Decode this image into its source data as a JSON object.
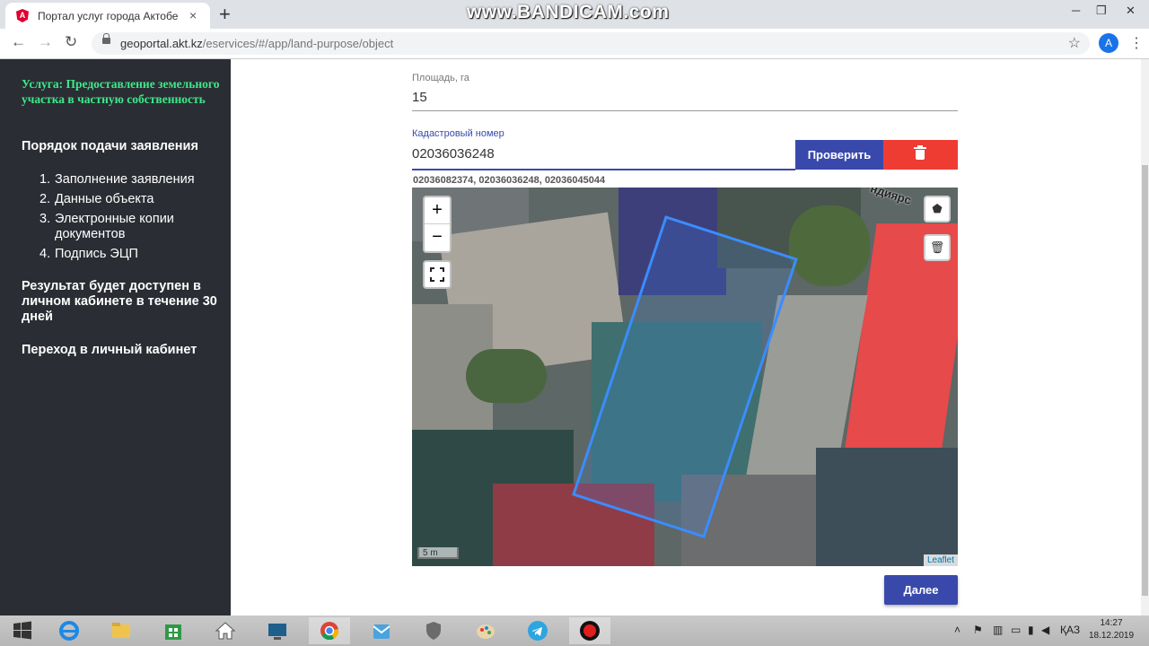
{
  "browser": {
    "tab_title": "Портал услуг города Актобе",
    "tab_close": "×",
    "new_tab": "+",
    "url_host": "geoportal.akt.kz",
    "url_path": "/eservices/#/app/land-purpose/object",
    "avatar_letter": "A",
    "watermark": "www.BANDICAM.com",
    "minimize": "─",
    "restore": "❐",
    "close": "✕"
  },
  "sidebar": {
    "service_title": "Услуга: Предоставление земельного участка в частную собственность",
    "procedure_heading": "Порядок подачи заявления",
    "steps": [
      {
        "num": "1.",
        "label": "Заполнение заявления"
      },
      {
        "num": "2.",
        "label": "Данные объекта"
      },
      {
        "num": "3.",
        "label": "Электронные копии документов"
      },
      {
        "num": "4.",
        "label": "Подпись ЭЦП"
      }
    ],
    "result_note": "Результат будет доступен в личном кабинете в течение 30 дней",
    "cabinet_link": "Переход в личный кабинет"
  },
  "form": {
    "area_label": "Площадь, га",
    "area_value": "15",
    "cadastral_label": "Кадастровый номер",
    "cadastral_value": "02036036248",
    "check_button": "Проверить",
    "cadastral_hint": "02036082374, 02036036248, 02036045044",
    "next_button": "Далее"
  },
  "map": {
    "zoom_in": "+",
    "zoom_out": "−",
    "scale": "5 m",
    "attribution": "Leaflet",
    "road_label": "ндиярс",
    "draw_polygon": "⬟",
    "delete_shape": "🗑"
  },
  "taskbar": {
    "lang": "ҚАЗ",
    "time": "14:27",
    "date": "18.12.2019"
  },
  "colors": {
    "sidebar_bg": "#2a2d33",
    "service_green": "#3ee88a",
    "primary_button": "#3949ab",
    "delete_button": "#ef3c33",
    "parcel_outline": "#3a8dff"
  }
}
